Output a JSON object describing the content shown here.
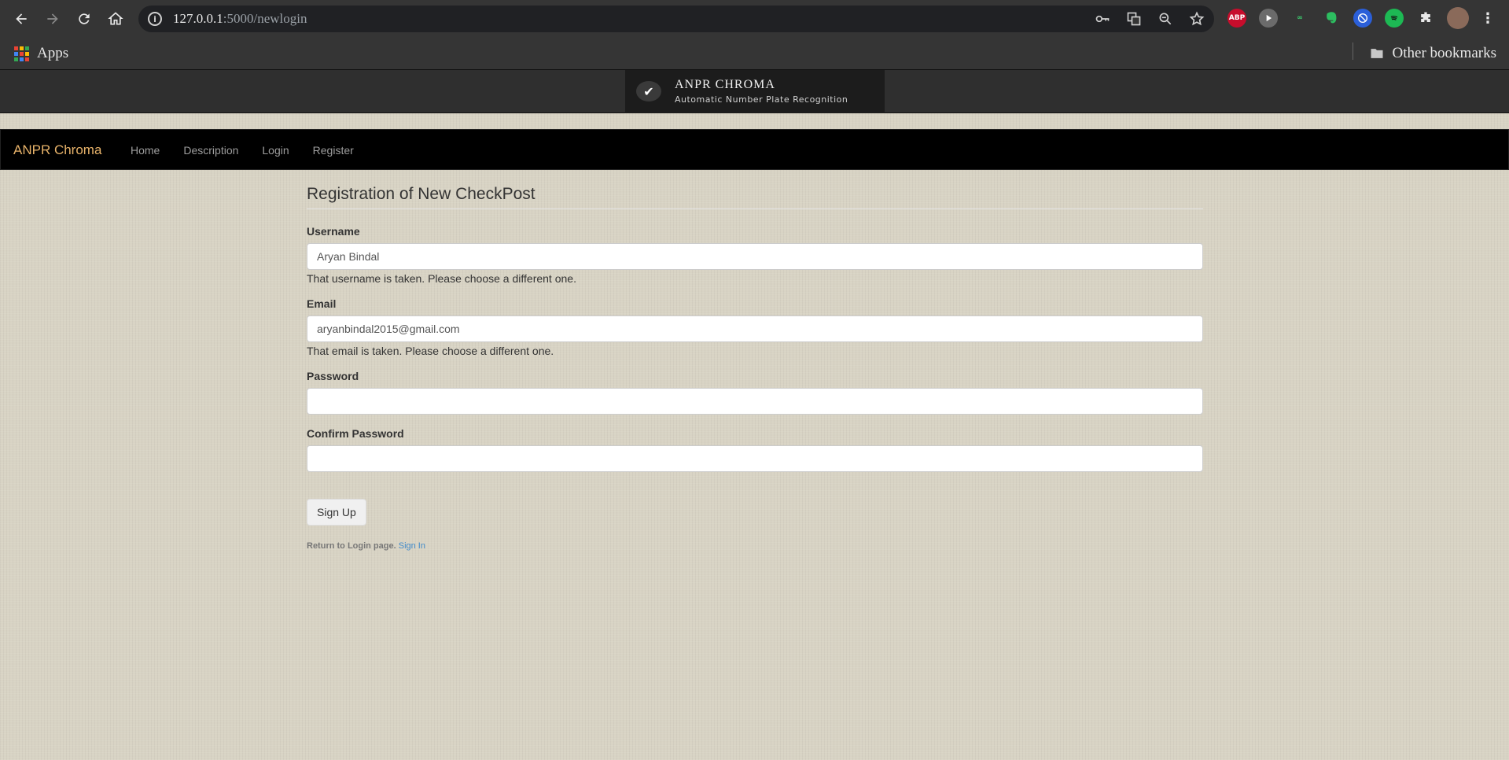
{
  "browser": {
    "url_host": "127.0.0.1",
    "url_path": ":5000/newlogin",
    "bookmarks": {
      "apps_label": "Apps",
      "other_label": "Other bookmarks"
    },
    "extensions": [
      {
        "name": "adblock-plus-icon",
        "label": "ABP",
        "color": "#c70d2c"
      },
      {
        "name": "play-extension-icon",
        "label": "",
        "color": "#6b6b6b"
      },
      {
        "name": "reader-extension-icon",
        "label": "",
        "color": "#353535"
      },
      {
        "name": "evernote-icon",
        "label": "",
        "color": "#2dbe60"
      },
      {
        "name": "block-extension-icon",
        "label": "",
        "color": "#2b5fd9"
      },
      {
        "name": "spotify-extension-icon",
        "label": "",
        "color": "#1db954"
      }
    ],
    "colors": {
      "toolbar": "#353535",
      "omnibox": "#202124"
    }
  },
  "banner": {
    "title": "ANPR CHROMA",
    "subtitle": "Automatic Number Plate Recognition"
  },
  "navbar": {
    "brand": "ANPR Chroma",
    "links": [
      "Home",
      "Description",
      "Login",
      "Register"
    ],
    "brand_color": "#e8b36a"
  },
  "form": {
    "legend": "Registration of New CheckPost",
    "username": {
      "label": "Username",
      "value": "Aryan Bindal",
      "error": "That username is taken. Please choose a different one."
    },
    "email": {
      "label": "Email",
      "value": "aryanbindal2015@gmail.com",
      "error": "That email is taken. Please choose a different one."
    },
    "password": {
      "label": "Password",
      "value": ""
    },
    "confirm_password": {
      "label": "Confirm Password",
      "value": ""
    },
    "submit_label": "Sign Up",
    "footer_text": "Return to Login page.",
    "footer_link": "Sign In"
  }
}
